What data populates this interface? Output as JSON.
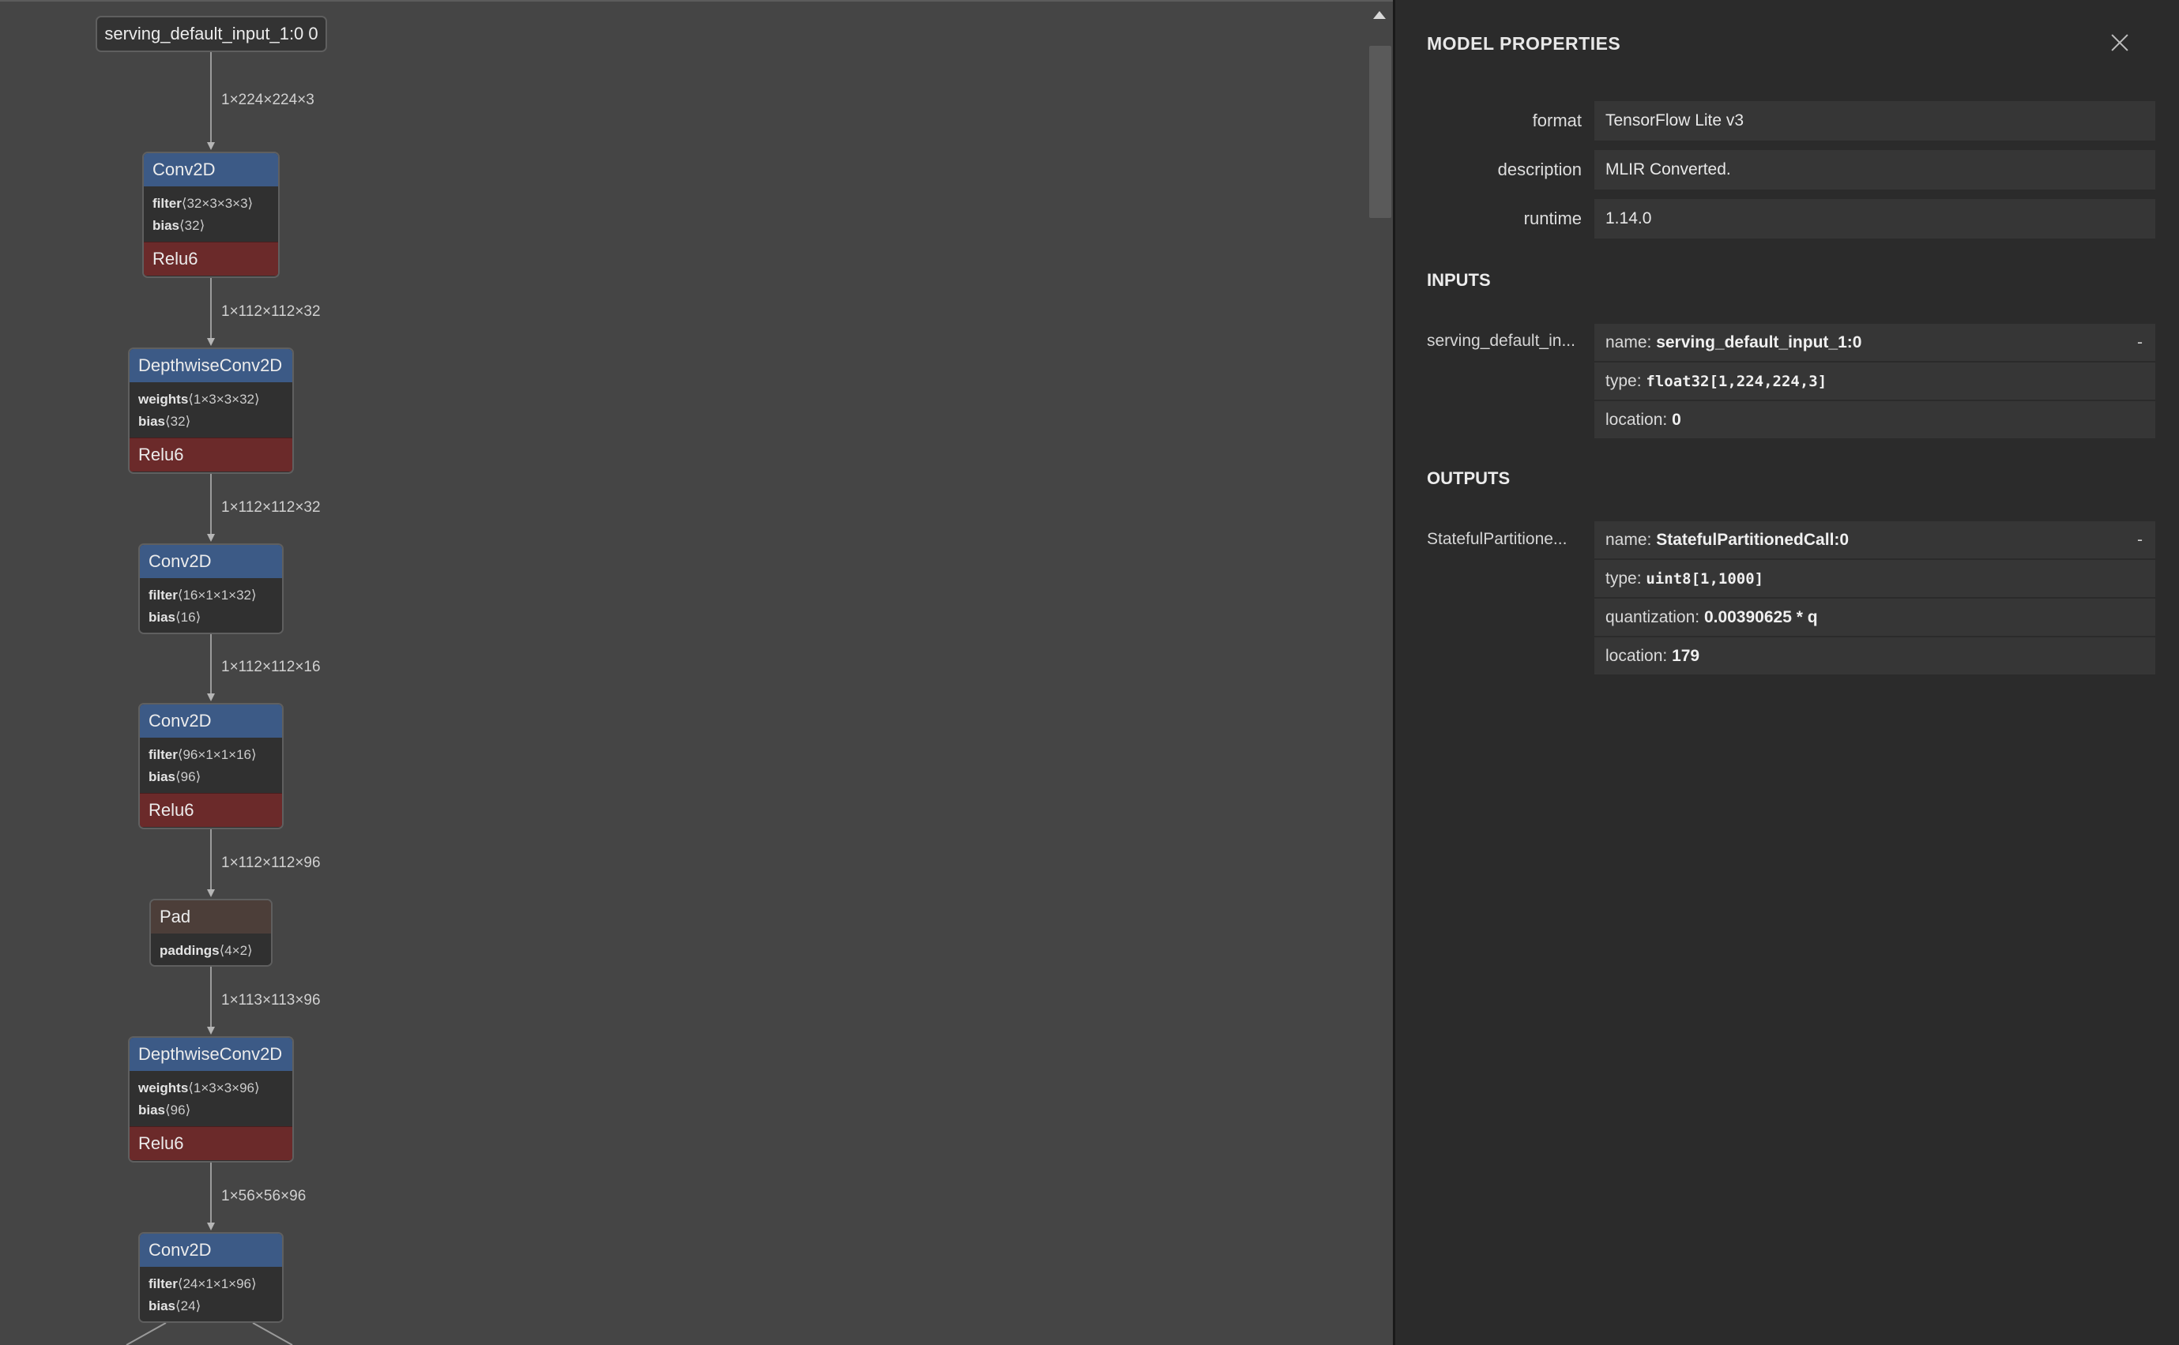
{
  "graph": {
    "input_node": {
      "label": "serving_default_input_1:0 0"
    },
    "edges": [
      "1×224×224×3",
      "1×112×112×32",
      "1×112×112×32",
      "1×112×112×16",
      "1×112×112×96",
      "1×113×113×96",
      "1×56×56×96"
    ],
    "nodes": [
      {
        "type": "Conv2D",
        "attrs": [
          {
            "name": "filter",
            "shape": "⟨32×3×3×3⟩"
          },
          {
            "name": "bias",
            "shape": "⟨32⟩"
          }
        ],
        "activation": "Relu6"
      },
      {
        "type": "DepthwiseConv2D",
        "attrs": [
          {
            "name": "weights",
            "shape": "⟨1×3×3×32⟩"
          },
          {
            "name": "bias",
            "shape": "⟨32⟩"
          }
        ],
        "activation": "Relu6"
      },
      {
        "type": "Conv2D",
        "attrs": [
          {
            "name": "filter",
            "shape": "⟨16×1×1×32⟩"
          },
          {
            "name": "bias",
            "shape": "⟨16⟩"
          }
        ],
        "activation": ""
      },
      {
        "type": "Conv2D",
        "attrs": [
          {
            "name": "filter",
            "shape": "⟨96×1×1×16⟩"
          },
          {
            "name": "bias",
            "shape": "⟨96⟩"
          }
        ],
        "activation": "Relu6"
      },
      {
        "type": "Pad",
        "attrs": [
          {
            "name": "paddings",
            "shape": "⟨4×2⟩"
          }
        ],
        "activation": ""
      },
      {
        "type": "DepthwiseConv2D",
        "attrs": [
          {
            "name": "weights",
            "shape": "⟨1×3×3×96⟩"
          },
          {
            "name": "bias",
            "shape": "⟨96⟩"
          }
        ],
        "activation": "Relu6"
      },
      {
        "type": "Conv2D",
        "attrs": [
          {
            "name": "filter",
            "shape": "⟨24×1×1×96⟩"
          },
          {
            "name": "bias",
            "shape": "⟨24⟩"
          }
        ],
        "activation": ""
      }
    ]
  },
  "panel": {
    "title": "MODEL PROPERTIES",
    "properties": [
      {
        "label": "format",
        "value": "TensorFlow Lite v3"
      },
      {
        "label": "description",
        "value": "MLIR Converted."
      },
      {
        "label": "runtime",
        "value": "1.14.0"
      }
    ],
    "inputs": {
      "title": "INPUTS",
      "label": "serving_default_in...",
      "name_key": "name: ",
      "name": "serving_default_input_1:0",
      "type_key": "type: ",
      "type": "float32[1,224,224,3]",
      "location_key": "location: ",
      "location": "0",
      "expand": "-"
    },
    "outputs": {
      "title": "OUTPUTS",
      "label": "StatefulPartitione...",
      "name_key": "name: ",
      "name": "StatefulPartitionedCall:0",
      "type_key": "type: ",
      "type": "uint8[1,1000]",
      "quant_key": "quantization: ",
      "quantization": "0.00390625 * q",
      "location_key": "location: ",
      "location": "179",
      "expand": "-"
    }
  }
}
